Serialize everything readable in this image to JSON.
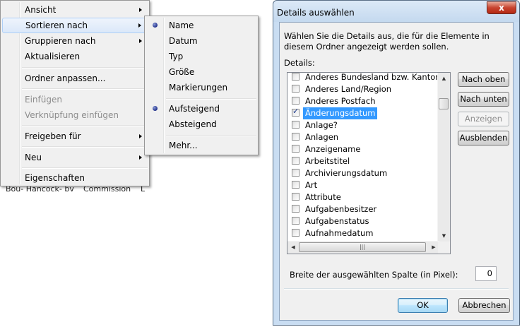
{
  "background": {
    "strip_texts": [
      "Bou- Hancock- bv",
      "Commission",
      "L"
    ]
  },
  "context_menu": {
    "items": [
      {
        "label": "Ansicht",
        "has_submenu": true,
        "disabled": false
      },
      {
        "label": "Sortieren nach",
        "has_submenu": true,
        "disabled": false,
        "highlighted": true
      },
      {
        "label": "Gruppieren nach",
        "has_submenu": true,
        "disabled": false
      },
      {
        "label": "Aktualisieren",
        "has_submenu": false,
        "disabled": false
      },
      {
        "label": "Ordner anpassen...",
        "has_submenu": false,
        "disabled": false
      },
      {
        "label": "Einfügen",
        "has_submenu": false,
        "disabled": true
      },
      {
        "label": "Verknüpfung einfügen",
        "has_submenu": false,
        "disabled": true
      },
      {
        "label": "Freigeben für",
        "has_submenu": true,
        "disabled": false
      },
      {
        "label": "Neu",
        "has_submenu": true,
        "disabled": false
      },
      {
        "label": "Eigenschaften",
        "has_submenu": false,
        "disabled": false
      }
    ]
  },
  "sort_submenu": {
    "items": [
      {
        "label": "Name",
        "selected": true
      },
      {
        "label": "Datum",
        "selected": false
      },
      {
        "label": "Typ",
        "selected": false
      },
      {
        "label": "Größe",
        "selected": false
      },
      {
        "label": "Markierungen",
        "selected": false
      },
      {
        "label": "Aufsteigend",
        "selected": true
      },
      {
        "label": "Absteigend",
        "selected": false
      },
      {
        "label": "Mehr...",
        "selected": false
      }
    ]
  },
  "dialog": {
    "title": "Details auswählen",
    "close_label": "x",
    "description": "Wählen Sie die Details aus, die für die Elemente in diesem Ordner angezeigt werden sollen.",
    "details_label": "Details:",
    "list": [
      {
        "label": "Anderes Bundesland bzw. Kanton",
        "checked": false
      },
      {
        "label": "Anderes Land/Region",
        "checked": false
      },
      {
        "label": "Anderes Postfach",
        "checked": false
      },
      {
        "label": "Änderungsdatum",
        "checked": true,
        "selected": true
      },
      {
        "label": "Anlage?",
        "checked": false
      },
      {
        "label": "Anlagen",
        "checked": false
      },
      {
        "label": "Anzeigename",
        "checked": false
      },
      {
        "label": "Arbeitstitel",
        "checked": false
      },
      {
        "label": "Archivierungsdatum",
        "checked": false
      },
      {
        "label": "Art",
        "checked": false
      },
      {
        "label": "Attribute",
        "checked": false
      },
      {
        "label": "Aufgabenbesitzer",
        "checked": false
      },
      {
        "label": "Aufgabenstatus",
        "checked": false
      },
      {
        "label": "Aufnahmedatum",
        "checked": false
      }
    ],
    "buttons": {
      "move_up": "Nach oben",
      "move_down": "Nach unten",
      "show": "Anzeigen",
      "hide": "Ausblenden",
      "ok": "OK",
      "cancel": "Abbrechen"
    },
    "width_label": "Breite der ausgewählten Spalte (in Pixel):",
    "width_value": "0"
  }
}
